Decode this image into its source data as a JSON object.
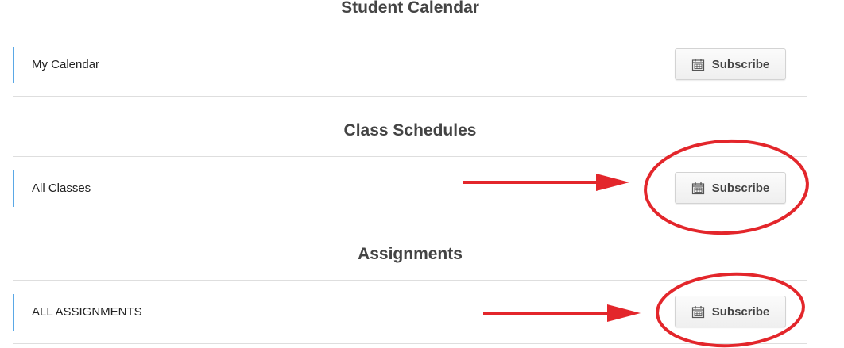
{
  "sections": [
    {
      "title": "Student Calendar",
      "row": {
        "label": "My Calendar",
        "button_label": "Subscribe",
        "button_icon": "calendar-icon"
      }
    },
    {
      "title": "Class Schedules",
      "row": {
        "label": "All Classes",
        "button_label": "Subscribe",
        "button_icon": "calendar-icon"
      }
    },
    {
      "title": "Assignments",
      "row": {
        "label": "ALL ASSIGNMENTS",
        "button_label": "Subscribe",
        "button_icon": "calendar-icon"
      }
    }
  ],
  "colors": {
    "row_accent": "#5aa8e6",
    "annotation": "#e3262b"
  }
}
